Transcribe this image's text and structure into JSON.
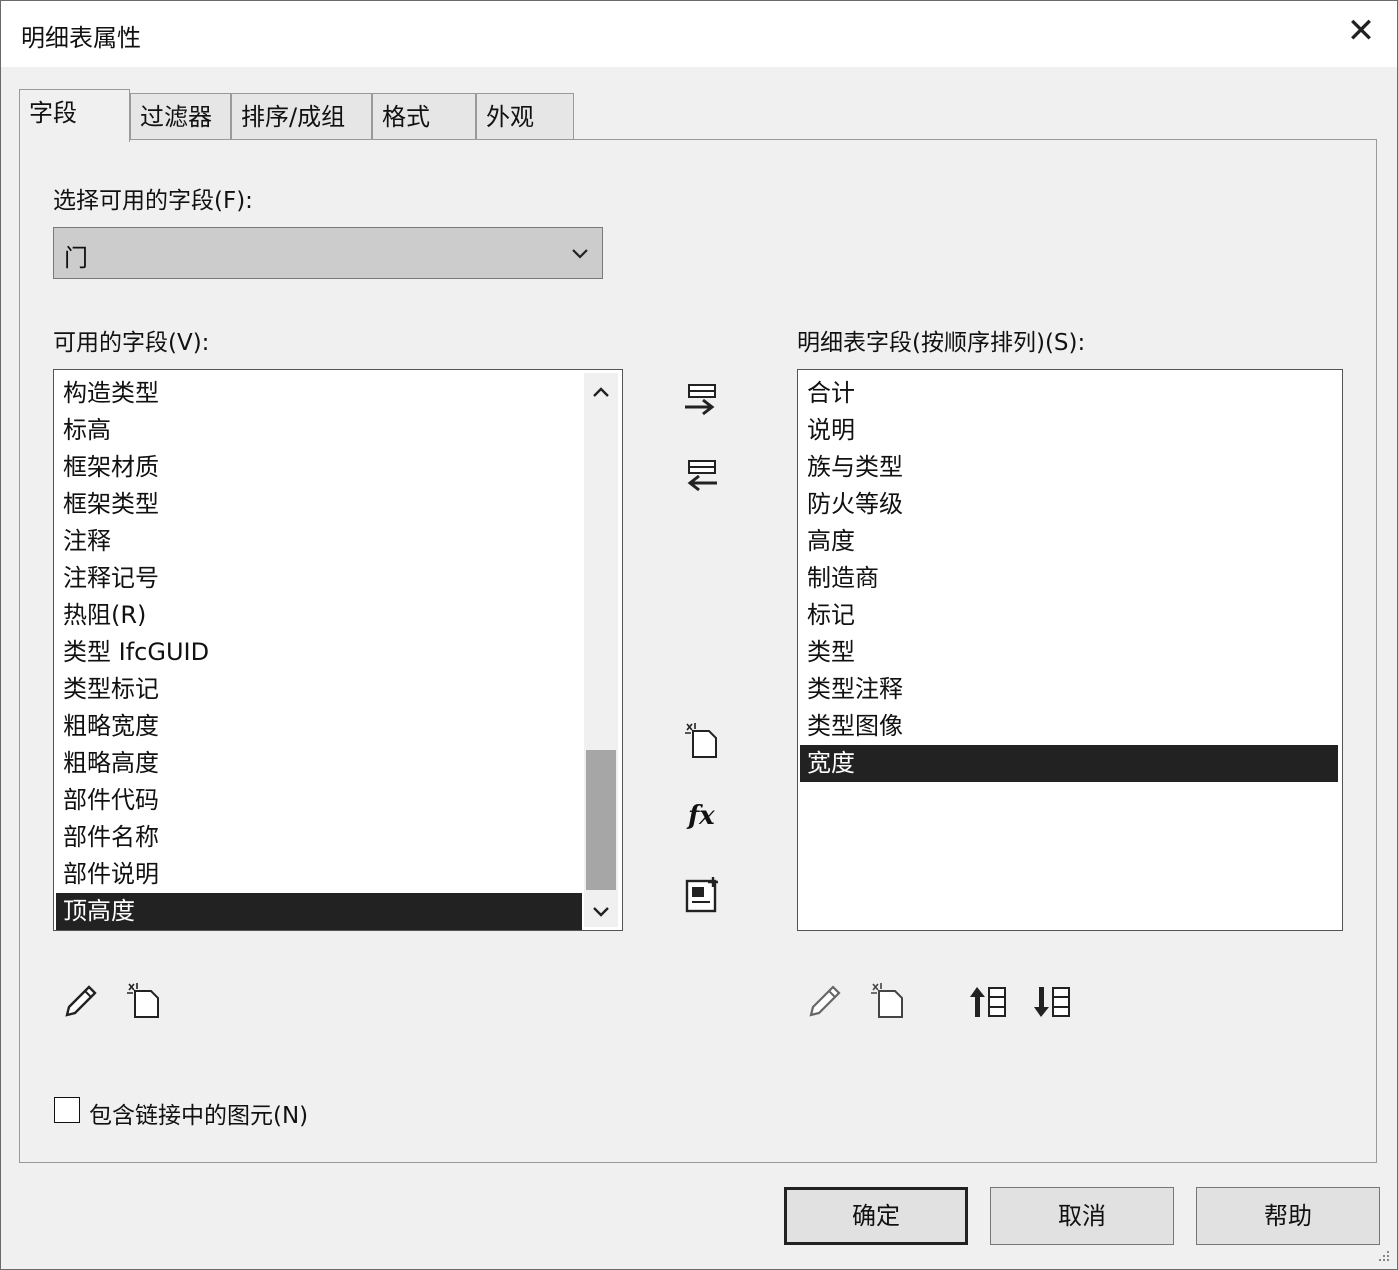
{
  "window": {
    "title": "明细表属性",
    "close_icon": "close-icon"
  },
  "tabs": [
    {
      "label": "字段",
      "active": true
    },
    {
      "label": "过滤器"
    },
    {
      "label": "排序/成组"
    },
    {
      "label": "格式"
    },
    {
      "label": "外观"
    }
  ],
  "fields_tab": {
    "select_label": "选择可用的字段(F):",
    "select_value": "门",
    "available_label": "可用的字段(V):",
    "available_items": [
      "构造类型",
      "标高",
      "框架材质",
      "框架类型",
      "注释",
      "注释记号",
      "热阻(R)",
      "类型 IfcGUID",
      "类型标记",
      "粗略宽度",
      "粗略高度",
      "部件代码",
      "部件名称",
      "部件说明",
      "顶高度"
    ],
    "available_selected": "顶高度",
    "scheduled_label": "明细表字段(按顺序排列)(S):",
    "scheduled_items": [
      "合计",
      "说明",
      "族与类型",
      "防火等级",
      "高度",
      "制造商",
      "标记",
      "类型",
      "类型注释",
      "类型图像",
      "宽度"
    ],
    "scheduled_selected": "宽度",
    "include_links_label": "包含链接中的图元(N)",
    "include_links_checked": false
  },
  "buttons": {
    "ok": "确定",
    "cancel": "取消",
    "help": "帮助"
  },
  "icons": [
    "add-field-icon",
    "remove-field-icon",
    "new-parameter-icon",
    "calculated-value-icon",
    "combine-parameters-icon",
    "edit-parameter-icon",
    "delete-parameter-icon",
    "move-up-icon",
    "move-down-icon",
    "chevron-down-icon",
    "scroll-up-icon",
    "scroll-down-icon"
  ]
}
